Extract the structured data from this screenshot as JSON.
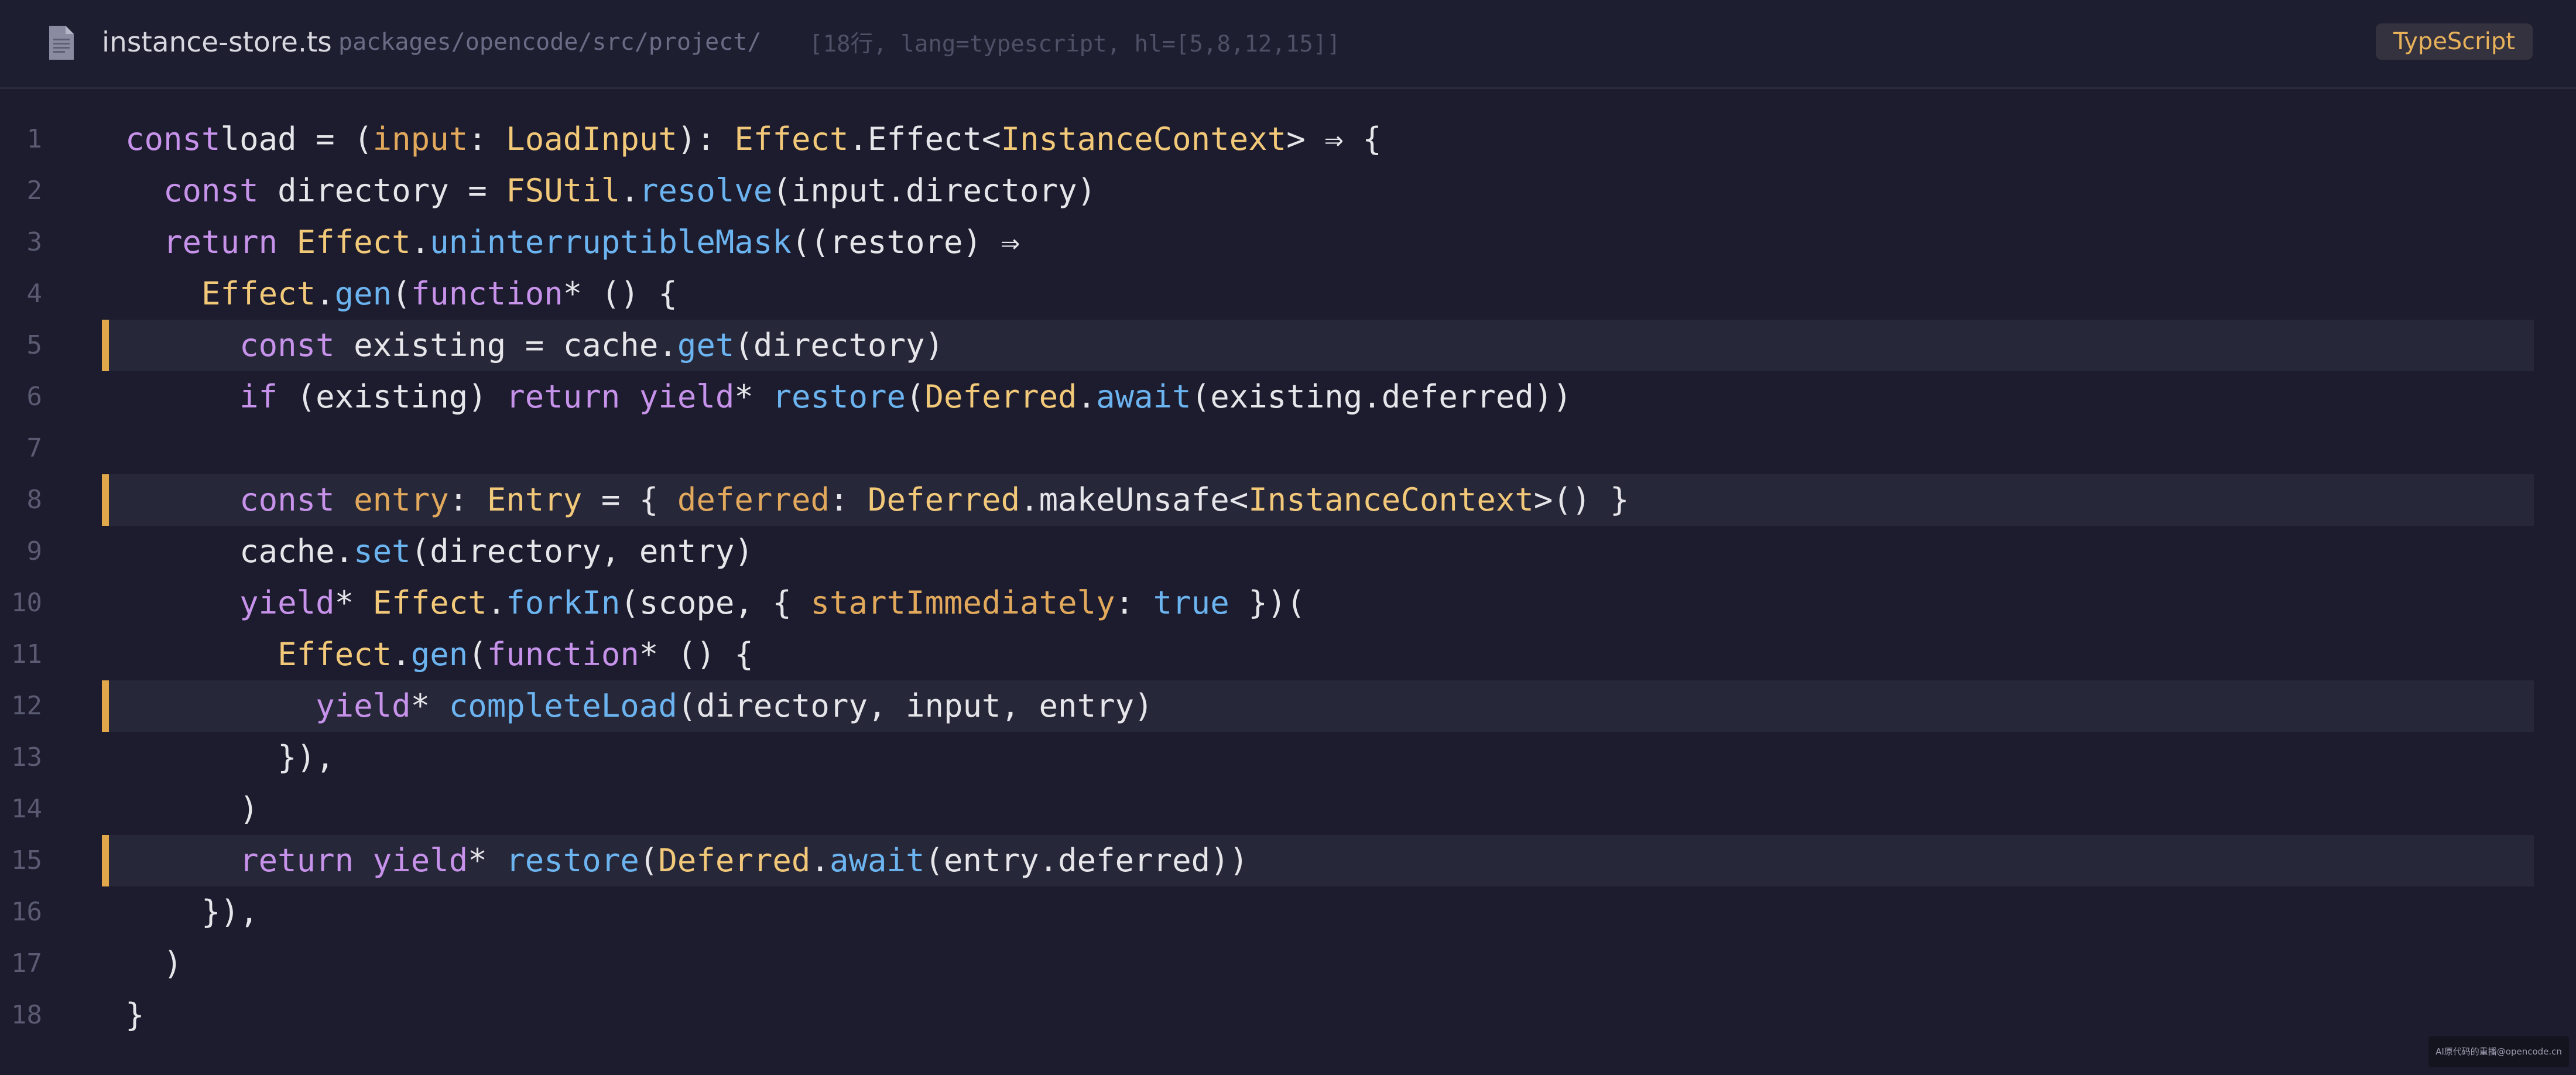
{
  "header": {
    "file_icon": "file-document-icon",
    "file_name": "instance-store.ts",
    "path": "packages/opencode/src/project/",
    "meta": "[18行, lang=typescript, hl=[5,8,12,15]]",
    "language": "TypeScript"
  },
  "colors": {
    "background": "#1c1c2e",
    "keyword": "#c792ea",
    "type": "#f2c879",
    "function": "#6cb4f0",
    "highlight_bar": "#e0a84a",
    "highlight_bg": "#27273a"
  },
  "code": {
    "highlighted_lines": [
      5,
      8,
      12,
      15
    ],
    "lines": [
      {
        "n": "1",
        "tokens": [
          [
            "k",
            "const"
          ],
          [
            "",
            "load = ("
          ],
          [
            "p",
            "input"
          ],
          [
            "",
            ": "
          ],
          [
            "t",
            "LoadInput"
          ],
          [
            "",
            "): "
          ],
          [
            "t",
            "Effect"
          ],
          [
            "",
            ".Effect<"
          ],
          [
            "t",
            "InstanceContext"
          ],
          [
            "",
            "> ⇒ {"
          ]
        ]
      },
      {
        "n": "2",
        "tokens": [
          [
            "",
            "  "
          ],
          [
            "k",
            "const"
          ],
          [
            "",
            " directory = "
          ],
          [
            "t",
            "FSUtil"
          ],
          [
            "",
            "."
          ],
          [
            "f",
            "resolve"
          ],
          [
            "",
            "(input.directory)"
          ]
        ]
      },
      {
        "n": "3",
        "tokens": [
          [
            "",
            "  "
          ],
          [
            "k",
            "return"
          ],
          [
            "",
            ""
          ],
          [
            "t",
            " Effect"
          ],
          [
            "",
            "."
          ],
          [
            "f",
            "uninterruptibleMask"
          ],
          [
            "",
            "((restore) ⇒"
          ]
        ]
      },
      {
        "n": "4",
        "tokens": [
          [
            "",
            "    "
          ],
          [
            "t",
            "Effect"
          ],
          [
            "",
            "."
          ],
          [
            "f",
            "gen"
          ],
          [
            "",
            "("
          ],
          [
            "k",
            "function"
          ],
          [
            "",
            "* () {"
          ]
        ]
      },
      {
        "n": "5",
        "tokens": [
          [
            "",
            "      "
          ],
          [
            "k",
            "const"
          ],
          [
            "",
            ""
          ],
          [
            "",
            ""
          ],
          [
            "",
            ""
          ],
          [
            "",
            ""
          ],
          [
            "",
            ""
          ],
          [
            "",
            " existing = cache."
          ],
          [
            "f",
            "get"
          ],
          [
            "",
            "(directory)"
          ]
        ]
      },
      {
        "n": "6",
        "tokens": [
          [
            "",
            "      "
          ],
          [
            "k",
            "if"
          ],
          [
            "",
            " (existing) "
          ],
          [
            "k",
            "return"
          ],
          [
            "",
            " "
          ],
          [
            "k",
            "yield"
          ],
          [
            "",
            "* "
          ],
          [
            "f",
            "restore"
          ],
          [
            "",
            "("
          ],
          [
            "t",
            "Deferred"
          ],
          [
            "",
            "."
          ],
          [
            "f",
            "await"
          ],
          [
            "",
            "(existing.deferred))"
          ]
        ]
      },
      {
        "n": "7",
        "tokens": []
      },
      {
        "n": "8",
        "tokens": [
          [
            "",
            "      "
          ],
          [
            "k",
            "const"
          ],
          [
            "",
            " "
          ],
          [
            "p",
            "entry"
          ],
          [
            "",
            ": "
          ],
          [
            "t",
            "Entry"
          ],
          [
            "",
            " = { "
          ],
          [
            "p",
            "deferred"
          ],
          [
            "",
            ": "
          ],
          [
            "t",
            "Deferred"
          ],
          [
            "",
            ".makeUnsafe<"
          ],
          [
            "t",
            "InstanceContext"
          ],
          [
            "",
            ">() }"
          ]
        ]
      },
      {
        "n": "9",
        "tokens": [
          [
            "",
            "      cache."
          ],
          [
            "f",
            "set"
          ],
          [
            "",
            "(directory, entry)"
          ]
        ]
      },
      {
        "n": "10",
        "tokens": [
          [
            "",
            "      "
          ],
          [
            "k",
            "yield"
          ],
          [
            "",
            "* "
          ],
          [
            "t",
            "Effect"
          ],
          [
            "",
            "."
          ],
          [
            "f",
            "forkIn"
          ],
          [
            "",
            "(scope, { "
          ],
          [
            "p",
            "startImmediately"
          ],
          [
            "",
            ": "
          ],
          [
            "b",
            "true"
          ],
          [
            "",
            " })("
          ]
        ]
      },
      {
        "n": "11",
        "tokens": [
          [
            "",
            "        "
          ],
          [
            "t",
            "Effect"
          ],
          [
            "",
            "."
          ],
          [
            "f",
            "gen"
          ],
          [
            "",
            "("
          ],
          [
            "k",
            "function"
          ],
          [
            "",
            "* () {"
          ]
        ]
      },
      {
        "n": "12",
        "tokens": [
          [
            "",
            "          "
          ],
          [
            "k",
            "yield"
          ],
          [
            "",
            "* "
          ],
          [
            "f",
            "completeLoad"
          ],
          [
            "",
            "(directory, input, entry)"
          ]
        ]
      },
      {
        "n": "13",
        "tokens": [
          [
            "",
            "        }),"
          ]
        ]
      },
      {
        "n": "14",
        "tokens": [
          [
            "",
            "      )"
          ]
        ]
      },
      {
        "n": "15",
        "tokens": [
          [
            "",
            "      "
          ],
          [
            "k",
            "return"
          ],
          [
            "",
            " "
          ],
          [
            "k",
            "yield"
          ],
          [
            "",
            "* "
          ],
          [
            "f",
            "restore"
          ],
          [
            "",
            "("
          ],
          [
            "t",
            "Deferred"
          ],
          [
            "",
            "."
          ],
          [
            "f",
            "await"
          ],
          [
            "",
            "(entry.deferred))"
          ]
        ]
      },
      {
        "n": "16",
        "tokens": [
          [
            "",
            "    }),"
          ]
        ]
      },
      {
        "n": "17",
        "tokens": [
          [
            "",
            "  )"
          ]
        ]
      },
      {
        "n": "18",
        "tokens": [
          [
            "",
            "}"
          ]
        ]
      }
    ]
  },
  "watermark": "AI原代码的重播@opencode.cn"
}
